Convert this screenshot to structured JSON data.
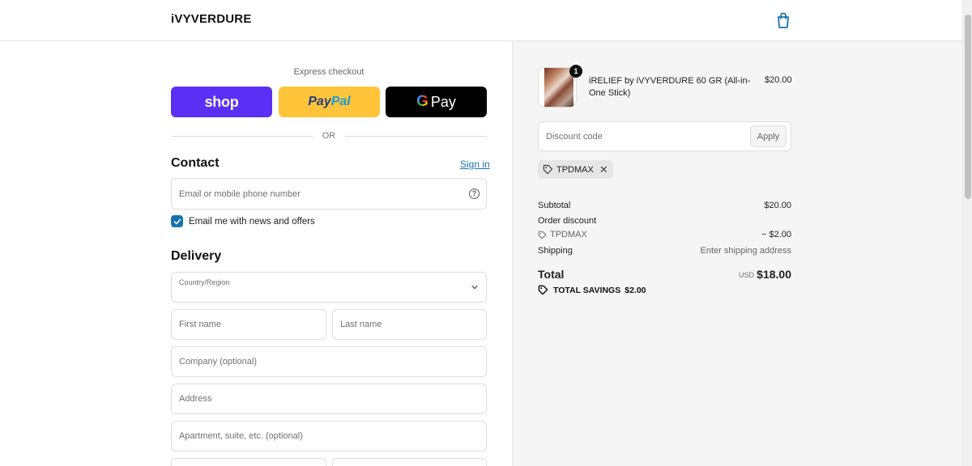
{
  "header": {
    "store_name": "iVYVERDURE",
    "bag_icon": "shopping-bag-icon",
    "accent": "#1773b0"
  },
  "express": {
    "label": "Express checkout",
    "shop_label": "shop",
    "paypal_part1": "Pay",
    "paypal_part2": "Pal",
    "gpay_g": "G",
    "gpay_label": "Pay",
    "shop_color": "#5a31f4",
    "paypal_color": "#ffc439"
  },
  "divider": {
    "text": "OR"
  },
  "contact": {
    "title": "Contact",
    "signin_label": "Sign in",
    "email_placeholder": "Email or mobile phone number",
    "help_icon": "?",
    "newsletter_label": "Email me with news and offers",
    "newsletter_checked": true
  },
  "delivery": {
    "title": "Delivery",
    "country_label": "Country/Region",
    "first_name_placeholder": "First name",
    "last_name_placeholder": "Last name",
    "company_placeholder": "Company (optional)",
    "address_placeholder": "Address",
    "apartment_placeholder": "Apartment, suite, etc. (optional)"
  },
  "cart": {
    "item_name": "iRELIEF by iVYVERDURE 60 GR (All-in-One Stick)",
    "item_price": "$20.00",
    "quantity": "1"
  },
  "discount": {
    "placeholder": "Discount code",
    "apply_label": "Apply",
    "applied_code": "TPDMAX"
  },
  "summary": {
    "subtotal_label": "Subtotal",
    "subtotal_value": "$20.00",
    "order_discount_label": "Order discount",
    "discount_code": "TPDMAX",
    "discount_value": "− $2.00",
    "shipping_label": "Shipping",
    "shipping_value": "Enter shipping address",
    "total_label": "Total",
    "currency": "USD",
    "total_value": "$18.00",
    "savings_label": "TOTAL SAVINGS",
    "savings_value": "$2.00"
  }
}
